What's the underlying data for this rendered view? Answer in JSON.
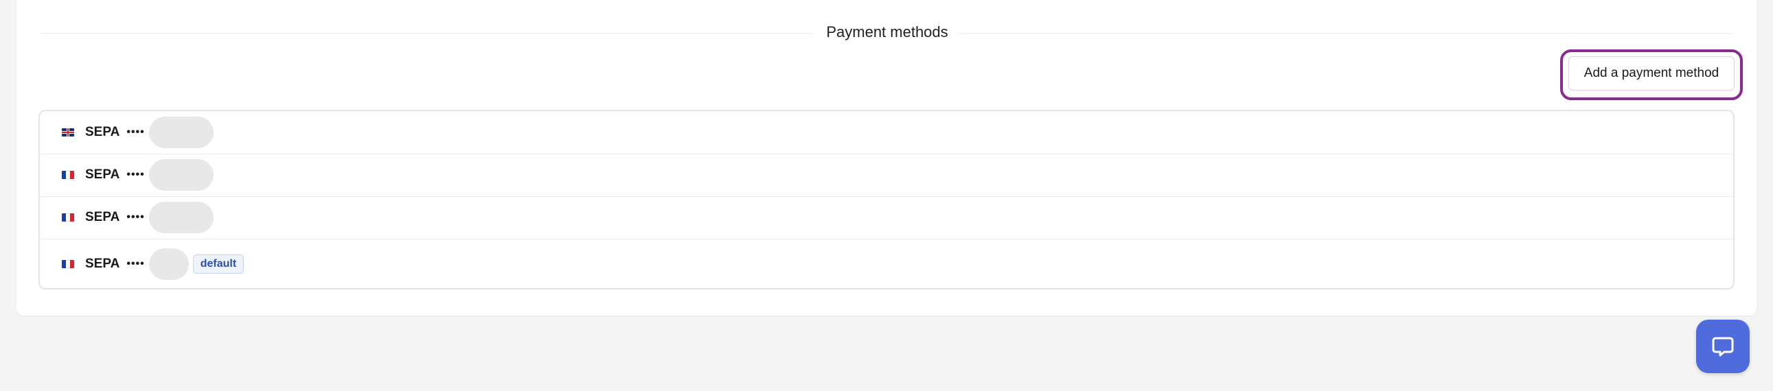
{
  "section": {
    "title": "Payment methods",
    "add_button_label": "Add a payment method"
  },
  "payment_methods": [
    {
      "flag": "gb-flag-icon",
      "type": "SEPA",
      "masked": "••••",
      "is_default": false
    },
    {
      "flag": "fr-flag-icon",
      "type": "SEPA",
      "masked": "••••",
      "is_default": false
    },
    {
      "flag": "fr-flag-icon",
      "type": "SEPA",
      "masked": "••••",
      "is_default": false
    },
    {
      "flag": "fr-flag-icon",
      "type": "SEPA",
      "masked": "••••",
      "is_default": true,
      "badge": "default"
    }
  ],
  "chat_widget": {
    "icon": "chat-bubble-icon"
  },
  "colors": {
    "highlight": "#8a2a8f",
    "chat_button": "#4f6bdc",
    "badge_text": "#2b4fb2"
  }
}
